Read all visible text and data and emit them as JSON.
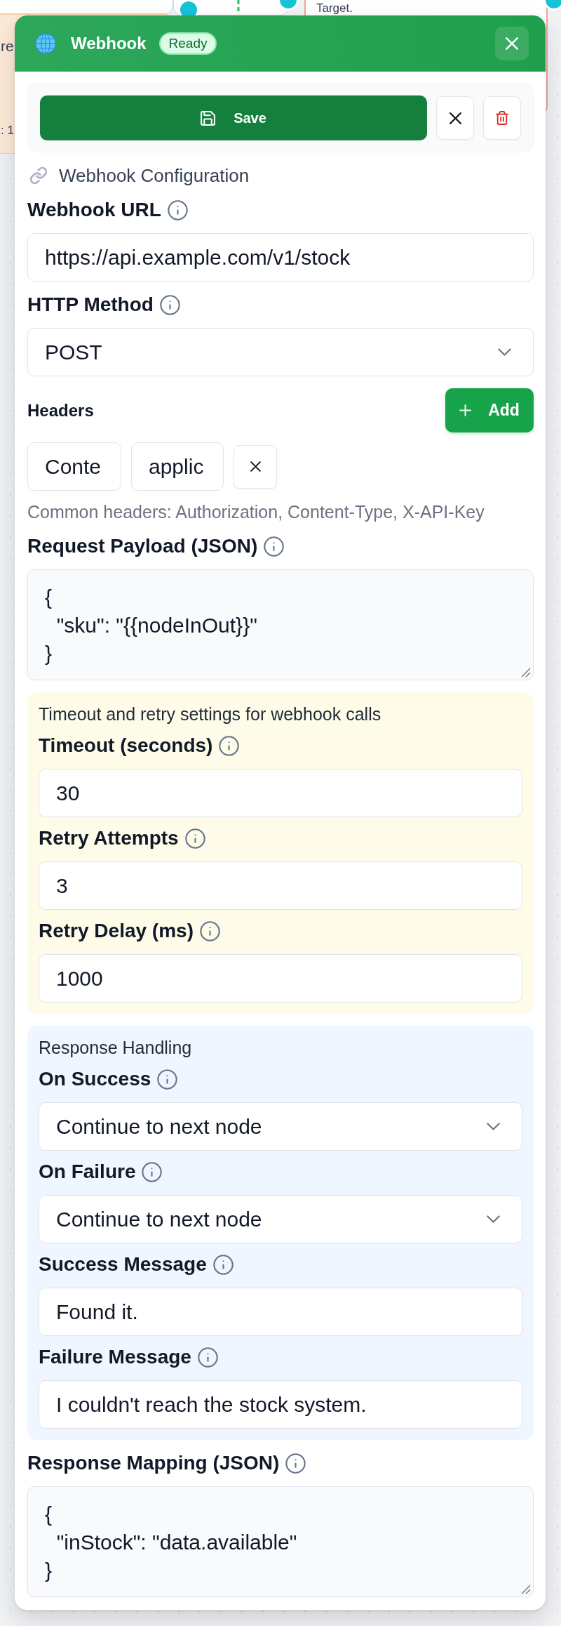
{
  "canvas": {
    "nodes": [
      {
        "kind": "note",
        "texts": [
          "re",
          ": 1"
        ]
      },
      {
        "kind": "error",
        "texts": [
          "Target."
        ]
      }
    ]
  },
  "panel": {
    "title": "Webhook",
    "badge": "Ready"
  },
  "actions": [
    {
      "kind": "save",
      "label": "Save"
    },
    {
      "kind": "cancel"
    },
    {
      "kind": "delete"
    }
  ],
  "section": {
    "title": "Webhook Configuration"
  },
  "fields": [
    {
      "kind": "text",
      "label": "Webhook URL",
      "value": "https://api.example.com/v1/stock"
    },
    {
      "kind": "select",
      "label": "HTTP Method",
      "value": "POST"
    },
    {
      "kind": "headers",
      "label": "Headers",
      "add_button": "Add",
      "rows": [
        {
          "key": "Conte",
          "value": "applic"
        }
      ],
      "hint": "Common headers: Authorization, Content-Type, X-API-Key"
    },
    {
      "kind": "code",
      "label": "Request Payload (JSON)",
      "value": "{\n  \"sku\": \"{{nodeInOut}}\"\n}"
    },
    {
      "kind": "group",
      "color": "#fefce8",
      "title": "Timeout and retry settings for webhook calls",
      "fields": [
        {
          "kind": "text",
          "label": "Timeout (seconds)",
          "value": "30"
        },
        {
          "kind": "text",
          "label": "Retry Attempts",
          "value": "3"
        },
        {
          "kind": "text",
          "label": "Retry Delay (ms)",
          "value": "1000"
        }
      ]
    },
    {
      "kind": "group",
      "color": "#eff6ff",
      "title": "Response Handling",
      "fields": [
        {
          "kind": "select",
          "label": "On Success",
          "value": "Continue to next node"
        },
        {
          "kind": "select",
          "label": "On Failure",
          "value": "Continue to next node"
        },
        {
          "kind": "text",
          "label": "Success Message",
          "value": "Found it."
        },
        {
          "kind": "text",
          "label": "Failure Message",
          "value": "I couldn't reach the stock system."
        }
      ]
    },
    {
      "kind": "code",
      "label": "Response Mapping (JSON)",
      "value": "{\n  \"inStock\": \"data.available\"\n}"
    }
  ]
}
